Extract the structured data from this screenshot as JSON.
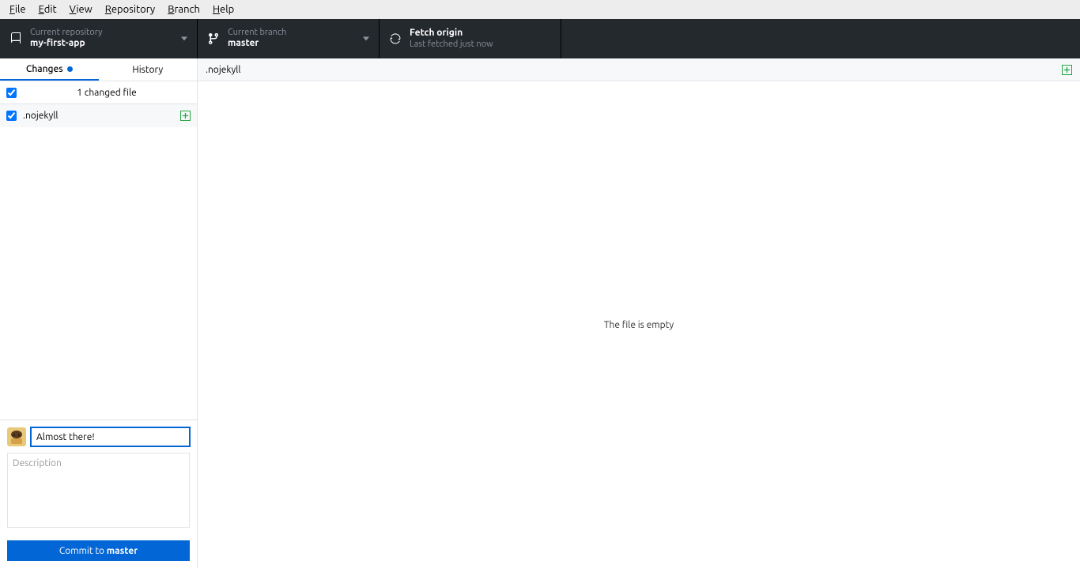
{
  "menubar": [
    "File",
    "Edit",
    "View",
    "Repository",
    "Branch",
    "Help"
  ],
  "toolbar": {
    "repo": {
      "label": "Current repository",
      "value": "my-first-app"
    },
    "branch": {
      "label": "Current branch",
      "value": "master"
    },
    "fetch": {
      "title": "Fetch origin",
      "sub": "Last fetched just now"
    }
  },
  "tabs": {
    "changes": "Changes",
    "history": "History"
  },
  "changes": {
    "count_label": "1 changed file",
    "files": [
      {
        "name": ".nojekyll",
        "status": "added"
      }
    ]
  },
  "commit": {
    "summary_value": "Almost there!",
    "desc_placeholder": "Description",
    "button_prefix": "Commit to ",
    "button_branch": "master"
  },
  "diff": {
    "file_header": ".nojekyll",
    "empty_msg": "The file is empty"
  }
}
